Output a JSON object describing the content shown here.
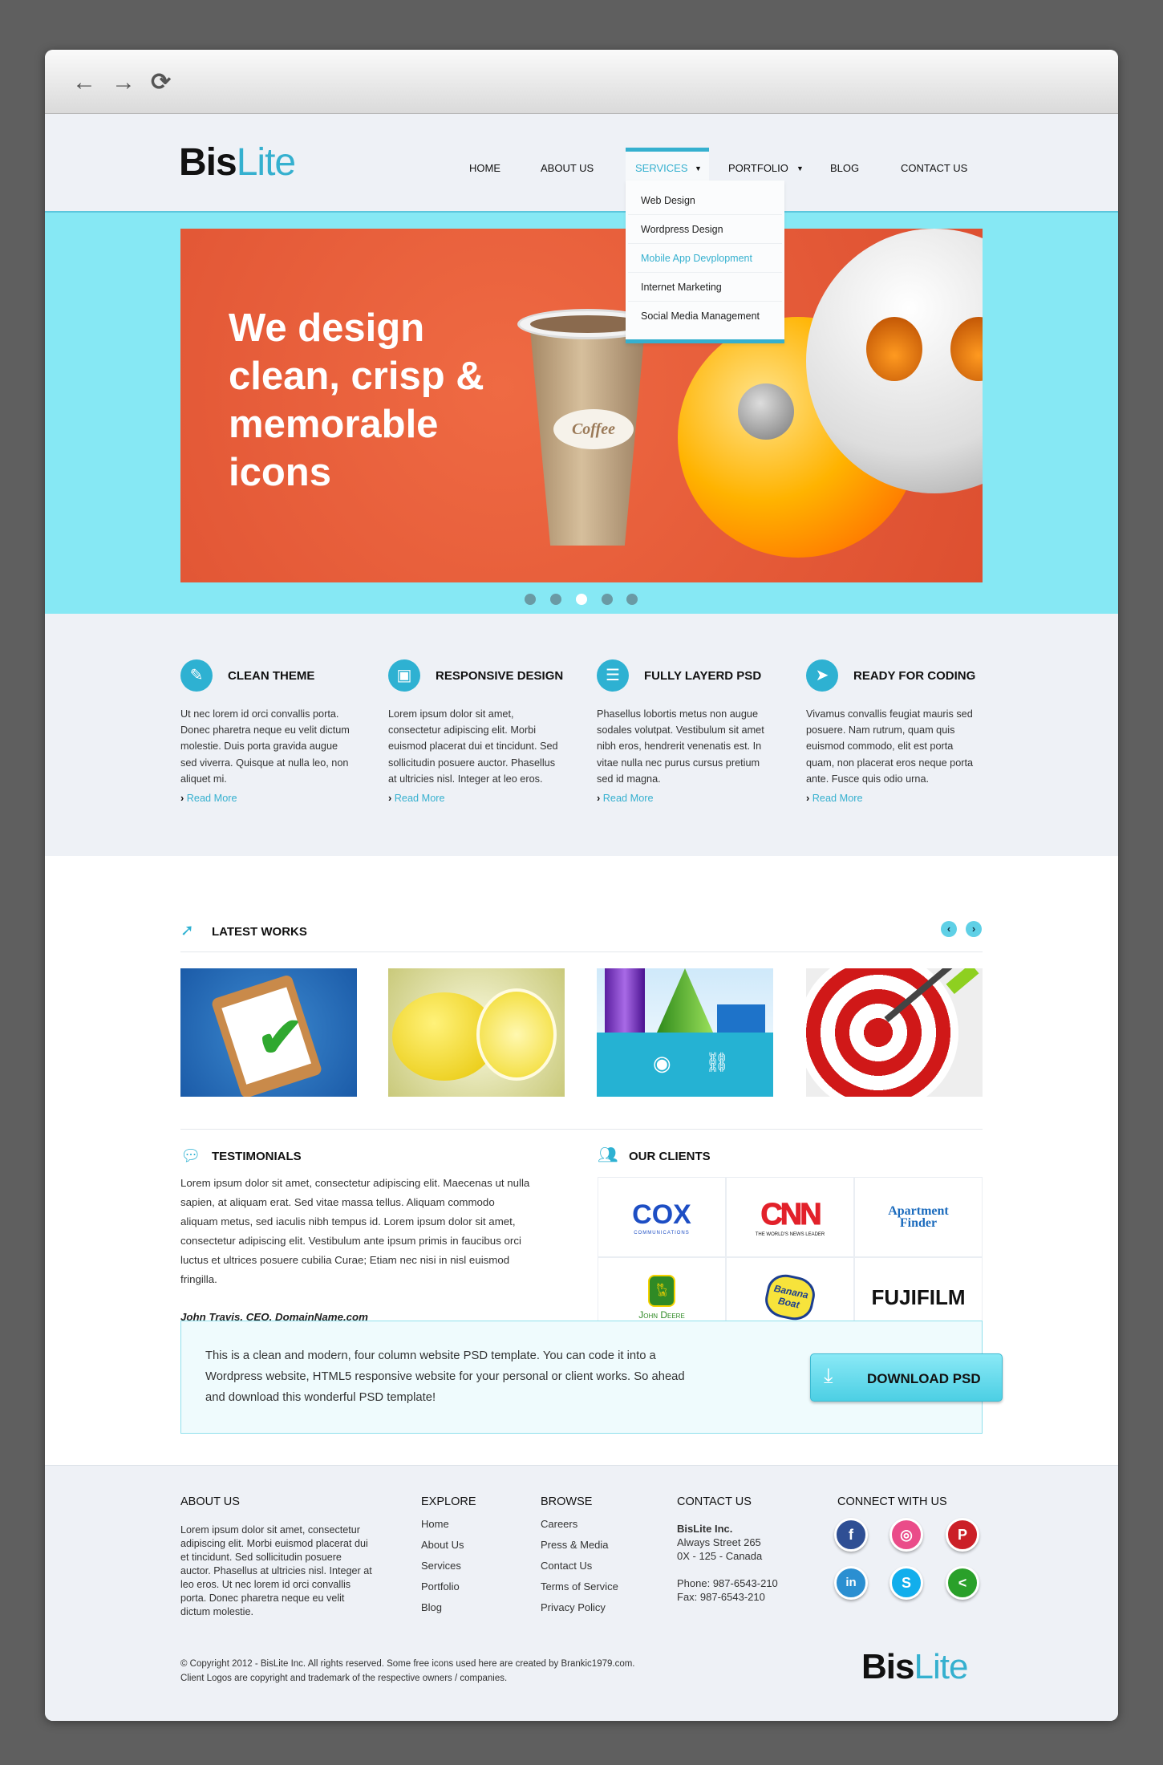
{
  "browser": {
    "back_icon": "←",
    "forward_icon": "→",
    "reload_icon": "⟳"
  },
  "logo": {
    "bold": "Bis",
    "light": "Lite"
  },
  "nav": {
    "items": [
      "HOME",
      "ABOUT US",
      "SERVICES",
      "PORTFOLIO",
      "BLOG",
      "CONTACT US"
    ],
    "active": "SERVICES"
  },
  "dropdown": [
    "Web Design",
    "Wordpress Design",
    "Mobile App Devplopment",
    "Internet Marketing",
    "Social Media Management"
  ],
  "hero": {
    "headline": "We design clean, crisp & memorable icons",
    "cup_label": "Coffee",
    "slides": 5,
    "active_slide": 3
  },
  "features": [
    {
      "title": "CLEAN THEME",
      "icon": "pencil-icon",
      "text": "Ut nec lorem id orci convallis porta. Donec pharetra neque eu velit dictum molestie. Duis porta gravida augue sed viverra. Quisque at nulla leo, non aliquet mi.",
      "link": "Read More"
    },
    {
      "title": "RESPONSIVE DESIGN",
      "icon": "screen-icon",
      "text": "Lorem ipsum dolor sit amet, consectetur adipiscing elit. Morbi euismod placerat dui et tincidunt. Sed sollicitudin posuere auctor. Phasellus at ultricies nisl. Integer at leo eros.",
      "link": "Read More"
    },
    {
      "title": "FULLY LAYERD PSD",
      "icon": "layers-icon",
      "text": "Phasellus lobortis metus non augue sodales volutpat. Vestibulum sit amet nibh eros, hendrerit venenatis est. In vitae nulla nec purus cursus pretium sed id magna.",
      "link": "Read More"
    },
    {
      "title": "READY FOR CODING",
      "icon": "paper-plane-icon",
      "text": "Vivamus convallis feugiat mauris sed posuere. Nam rutrum, quam quis euismod commodo, elit est porta quam, non placerat eros neque porta ante. Fusce quis odio urna.",
      "link": "Read More"
    }
  ],
  "latest_works": {
    "title": "LATEST WORKS",
    "prev": "‹",
    "next": "›"
  },
  "testimonials": {
    "title": "TESTIMONIALS",
    "text": "Lorem ipsum dolor sit amet, consectetur adipiscing elit. Maecenas ut nulla sapien, at aliquam erat. Sed vitae massa tellus. Aliquam commodo aliquam metus, sed iaculis nibh tempus id. Lorem ipsum dolor sit amet, consectetur adipiscing elit. Vestibulum ante ipsum primis in faucibus orci luctus et ultrices posuere cubilia Curae; Etiam nec nisi in nisl euismod fringilla.",
    "author": "John Travis, CEO, DomainName.com"
  },
  "clients": {
    "title": "OUR CLIENTS",
    "logos": [
      "COX",
      "CNN",
      "Apartment Finder",
      "John Deere",
      "Banana Boat",
      "FUJIFILM"
    ],
    "cox_sub": "COMMUNICATIONS",
    "cnn_sub": "THE WORLD'S NEWS LEADER"
  },
  "cta": {
    "text": "This is a clean and modern, four column website PSD template. You can code it into a Wordpress website, HTML5 responsive website for your personal or client works. So ahead and download this wonderful PSD template!",
    "button": "DOWNLOAD PSD"
  },
  "footer": {
    "about": {
      "title": "ABOUT US",
      "text": "Lorem ipsum dolor sit amet, consectetur adipiscing elit. Morbi euismod placerat dui et tincidunt. Sed sollicitudin posuere auctor. Phasellus at ultricies nisl. Integer at leo eros. Ut nec lorem id orci convallis porta. Donec pharetra neque eu velit dictum molestie."
    },
    "explore": {
      "title": "EXPLORE",
      "links": [
        "Home",
        "About Us",
        "Services",
        "Portfolio",
        "Blog"
      ]
    },
    "browse": {
      "title": "BROWSE",
      "links": [
        "Careers",
        "Press & Media",
        "Contact Us",
        "Terms of Service",
        "Privacy Policy"
      ]
    },
    "contact": {
      "title": "CONTACT US",
      "company": "BisLite Inc.",
      "street": "Always Street 265",
      "city": "0X - 125 - Canada",
      "phone": "Phone: 987-6543-210",
      "fax": "Fax: 987-6543-210"
    },
    "connect": {
      "title": "CONNECT WITH US",
      "networks": [
        "facebook",
        "dribbble",
        "pinterest",
        "linkedin",
        "skype",
        "share"
      ]
    },
    "copyright": "© Copyright 2012 - BisLite Inc. All rights reserved. Some free icons used here are created by Brankic1979.com.",
    "copyright2": "Client Logos are copyright and trademark of the respective owners / companies."
  },
  "colors": {
    "accent": "#35b0cf",
    "band": "#86e8f4",
    "hero": "#e35a38"
  }
}
